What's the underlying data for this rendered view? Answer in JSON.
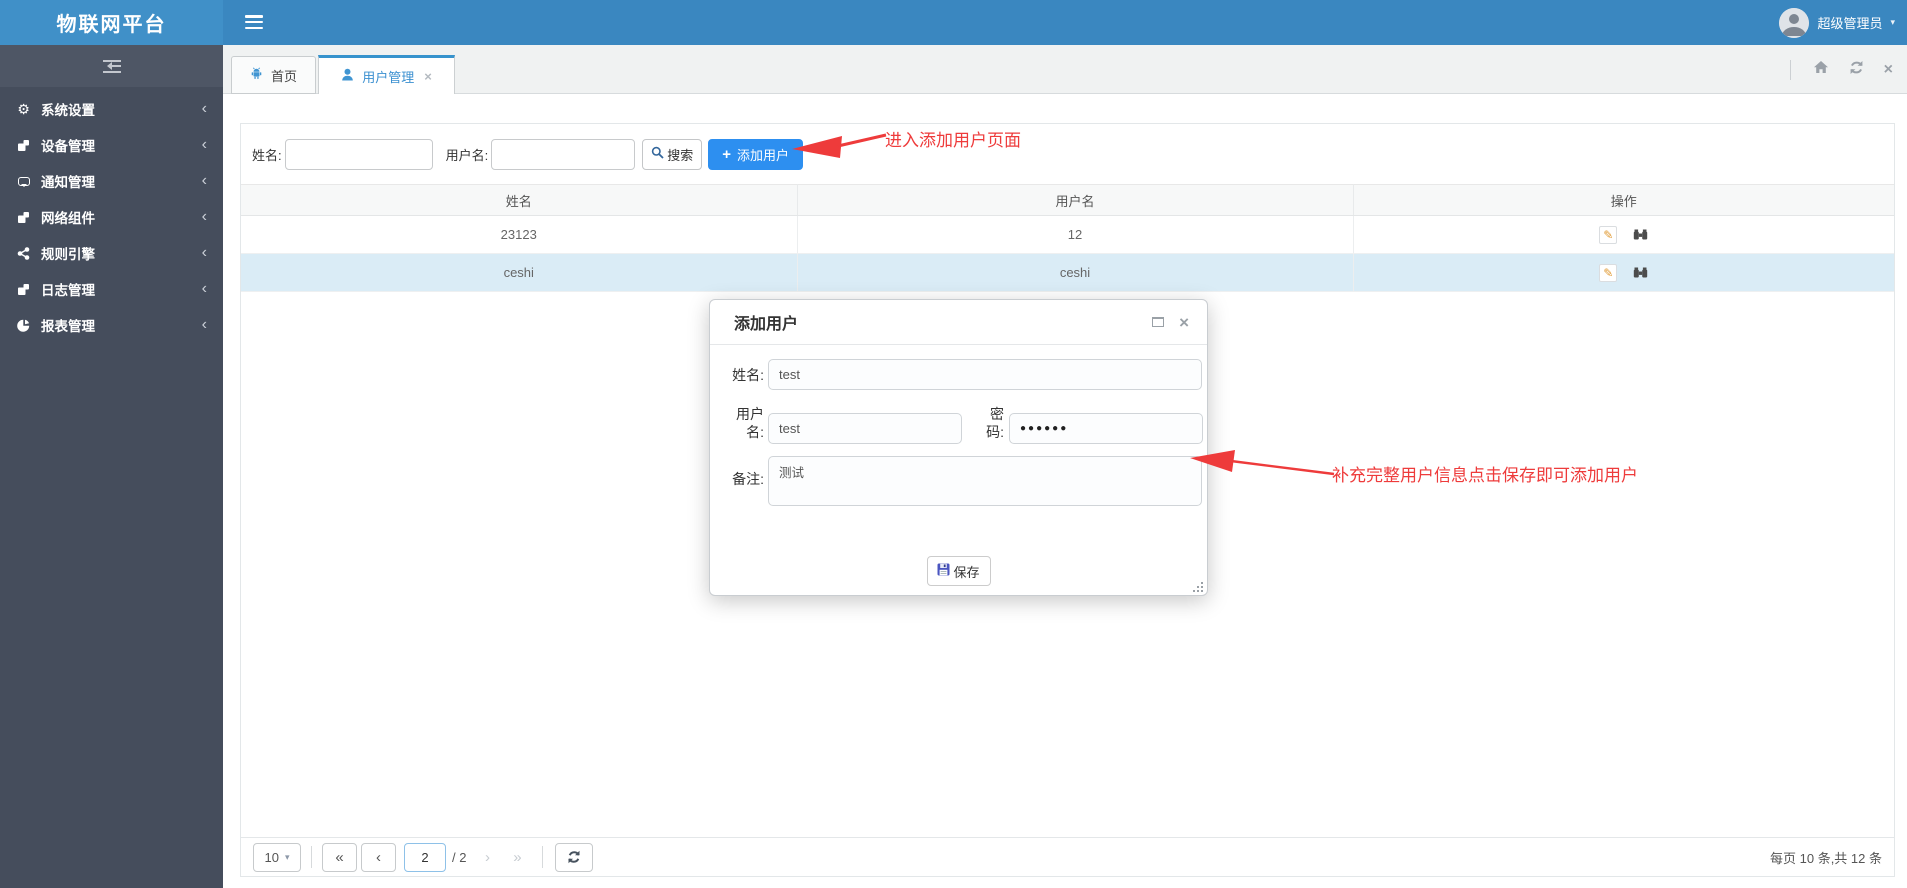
{
  "app": {
    "title": "物联网平台"
  },
  "topbar": {
    "user": "超级管理员"
  },
  "glyphs": {
    "gear": "⚙",
    "caret_down": "▾",
    "chevron_left": "‹",
    "close": "×",
    "plus": "+",
    "pencil": "✎"
  },
  "sidebar": {
    "items": [
      {
        "icon": "gears-icon",
        "label": "系统设置"
      },
      {
        "icon": "module-icon",
        "label": "设备管理"
      },
      {
        "icon": "comment-icon",
        "label": "通知管理"
      },
      {
        "icon": "module-icon",
        "label": "网络组件"
      },
      {
        "icon": "share-icon",
        "label": "规则引擎"
      },
      {
        "icon": "module-icon",
        "label": "日志管理"
      },
      {
        "icon": "pie-chart-icon",
        "label": "报表管理"
      }
    ]
  },
  "tabs": [
    {
      "label": "首页",
      "icon": "android-icon"
    },
    {
      "label": "用户管理",
      "icon": "user-icon",
      "closable": true
    }
  ],
  "toolbar": {
    "name_label": "姓名:",
    "name_value": "",
    "username_label": "用户名:",
    "username_value": "",
    "search_label": "搜索",
    "add_label": "添加用户"
  },
  "table": {
    "headers": [
      "姓名",
      "用户名",
      "操作"
    ],
    "rows": [
      {
        "name": "23123",
        "username": "12"
      },
      {
        "name": "ceshi",
        "username": "ceshi",
        "highlighted": true
      }
    ],
    "row_action_icons": [
      "edit-pencil-icon",
      "binoculars-icon"
    ]
  },
  "annotations": {
    "enter_add_user": "进入添加用户页面",
    "save_hint": "补充完整用户信息点击保存即可添加用户"
  },
  "modal": {
    "title": "添加用户",
    "name_label": "姓名:",
    "name_value": "test",
    "username_label": "用户名:",
    "username_value": "test",
    "password_label": "密码:",
    "password_value": "●●●●●●",
    "remark_label": "备注:",
    "remark_value": "测试",
    "save_label": "保存"
  },
  "pagination": {
    "page_size": "10",
    "first": "«",
    "prev": "‹",
    "page": "2",
    "of": "/ 2",
    "next": "›",
    "last": "»",
    "summary": "每页 10 条,共 12 条"
  },
  "colors": {
    "topbar": "#3a87c0",
    "sidebar": "#454d5c",
    "accent_button": "#2d8ff0",
    "active_tab_border": "#3793cd",
    "row_highlight": "#daecf6",
    "annotation_red": "#ee3b3b"
  }
}
